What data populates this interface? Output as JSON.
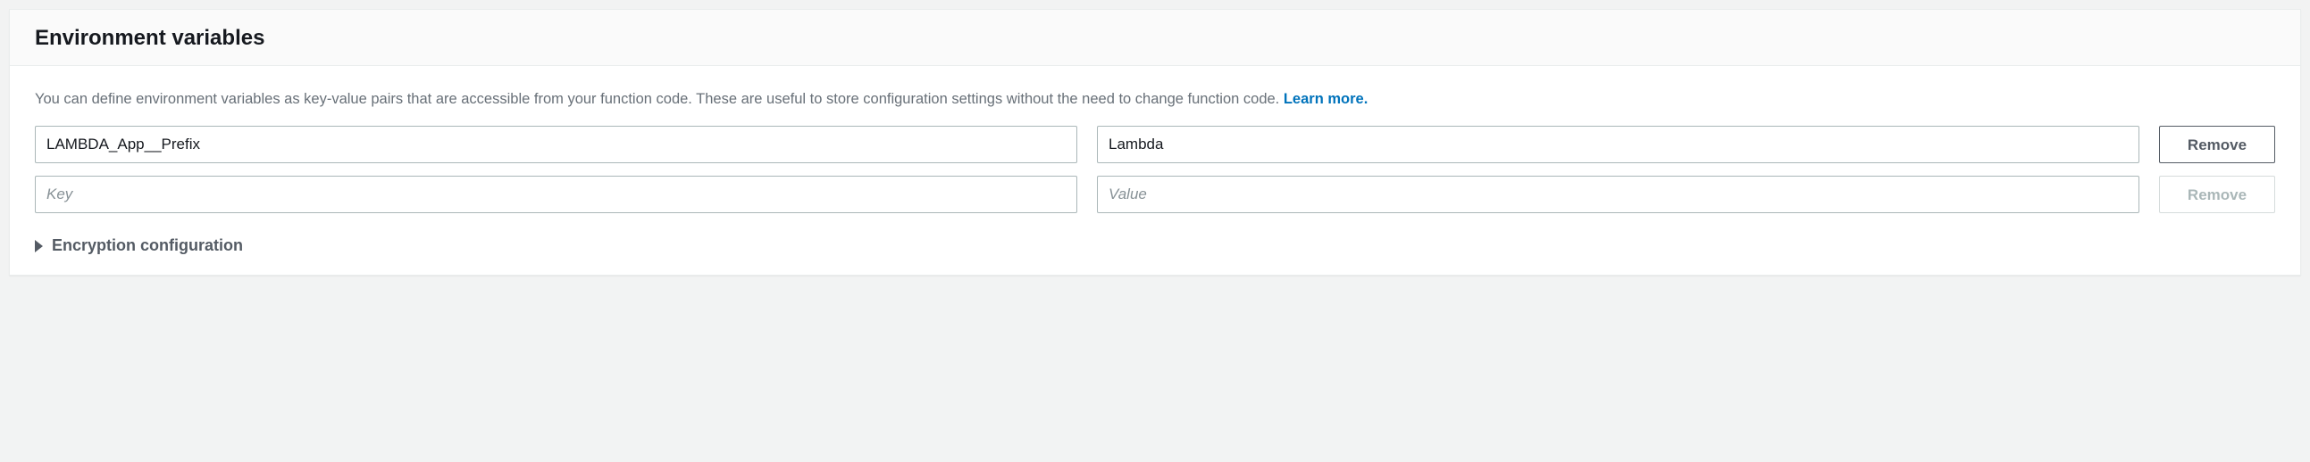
{
  "header": {
    "title": "Environment variables"
  },
  "description": {
    "text": "You can define environment variables as key-value pairs that are accessible from your function code. These are useful to store configuration settings without the need to change function code. ",
    "learn_more": "Learn more."
  },
  "placeholders": {
    "key": "Key",
    "value": "Value"
  },
  "buttons": {
    "remove": "Remove"
  },
  "rows": [
    {
      "key": "LAMBDA_App__Prefix",
      "value": "Lambda",
      "remove_enabled": true
    },
    {
      "key": "",
      "value": "",
      "remove_enabled": false
    }
  ],
  "expand_section": {
    "label": "Encryption configuration"
  }
}
